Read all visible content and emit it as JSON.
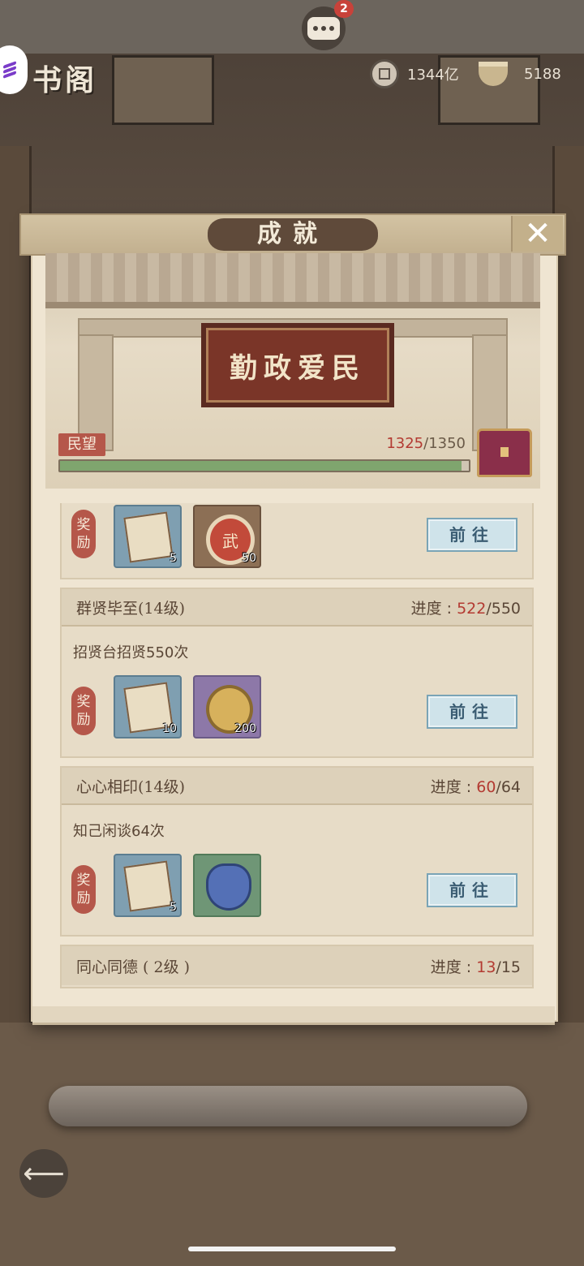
{
  "topbar": {
    "chat_badge": "2"
  },
  "page": {
    "title": "书阁"
  },
  "resources": {
    "coins": "1344亿",
    "ingots": "5188"
  },
  "dialog": {
    "title": "成就",
    "banner": {
      "plaque": "勤政爱民",
      "reputation_label": "民望",
      "progress_current": "1325",
      "progress_total": "/1350",
      "progress_fraction": 0.982
    }
  },
  "achievements": [
    {
      "reward_label_1": "奖",
      "reward_label_2": "励",
      "rewards": [
        {
          "icon": "book-reward-icon",
          "count": "5"
        },
        {
          "icon": "wu-token-icon",
          "count": "50"
        }
      ],
      "goto": "前往"
    },
    {
      "name": "群贤毕至(14级)",
      "progress_label": "进度 : ",
      "progress_current": "522",
      "progress_total": "/550",
      "desc": "招贤台招贤550次",
      "reward_label_1": "奖",
      "reward_label_2": "励",
      "rewards": [
        {
          "icon": "book-reward-icon",
          "count": "10"
        },
        {
          "icon": "gold-coin-icon",
          "count": "200"
        }
      ],
      "goto": "前往"
    },
    {
      "name": "心心相印(14级)",
      "progress_label": "进度 : ",
      "progress_current": "60",
      "progress_total": "/64",
      "desc": "知己闲谈64次",
      "reward_label_1": "奖",
      "reward_label_2": "励",
      "rewards": [
        {
          "icon": "book-reward-icon",
          "count": "5"
        },
        {
          "icon": "pouch-icon",
          "count": ""
        }
      ],
      "goto": "前往"
    },
    {
      "name": "同心同德 ( 2级 )",
      "progress_label": "进度 : ",
      "progress_current": "13",
      "progress_total": "/15"
    }
  ]
}
